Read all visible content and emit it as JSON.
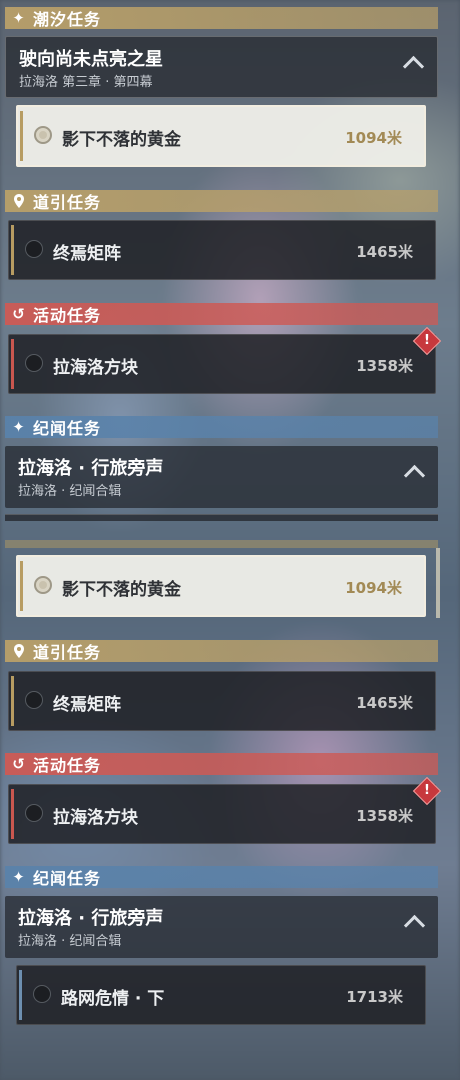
{
  "sections": {
    "tide": {
      "label": "潮汐任务",
      "icon": "sparkle-icon"
    },
    "guide": {
      "label": "道引任务",
      "icon": "location-pin-icon"
    },
    "event": {
      "label": "活动任务",
      "icon": "event-loop-icon"
    },
    "story": {
      "label": "纪闻任务",
      "icon": "sparkle-icon"
    }
  },
  "tide_group": {
    "title": "驶向尚未点亮之星",
    "subtitle": "拉海洛 第三章 · 第四幕"
  },
  "story_group": {
    "title": "拉海洛 · 行旅旁声",
    "subtitle": "拉海洛 · 纪闻合辑"
  },
  "tasks": {
    "tide_task": {
      "name": "影下不落的黄金",
      "distance": "1094米"
    },
    "guide_task": {
      "name": "终焉矩阵",
      "distance": "1465米"
    },
    "event_task": {
      "name": "拉海洛方块",
      "distance": "1358米"
    },
    "story_task": {
      "name": "路网危情 · 下",
      "distance": "1713米"
    }
  },
  "colors": {
    "gold": "#b79c62",
    "red": "#c9574f",
    "blue": "#6d8fb0",
    "warning": "#c7383d"
  },
  "warning_glyph": "!"
}
